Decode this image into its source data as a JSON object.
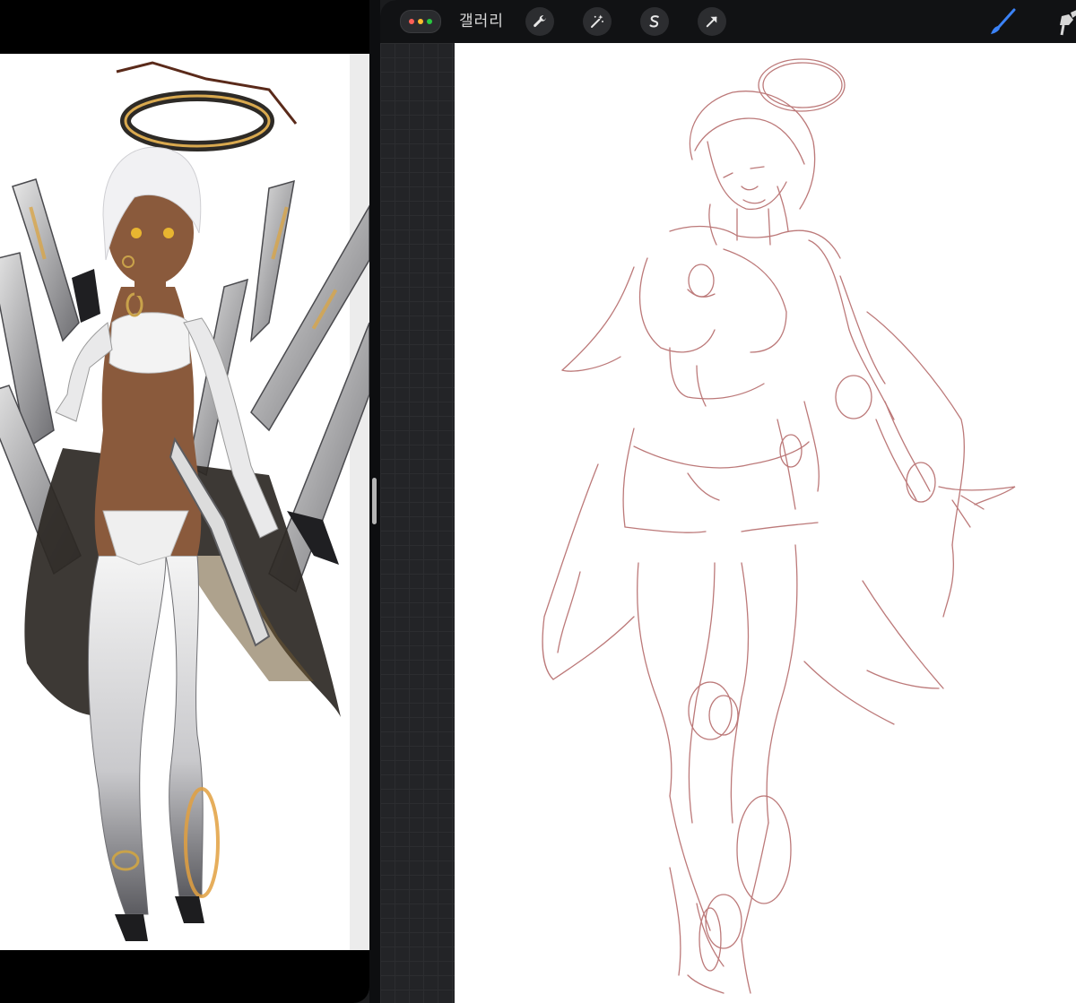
{
  "toolbar": {
    "gallery_label": "갤러리",
    "window_dots": [
      {
        "name": "red-dot",
        "color": "#ff5f57"
      },
      {
        "name": "yellow-dot",
        "color": "#febc2e"
      },
      {
        "name": "green-dot",
        "color": "#28c840"
      }
    ],
    "tools": [
      {
        "name": "actions-wrench-icon"
      },
      {
        "name": "adjustments-wand-icon"
      },
      {
        "name": "selection-s-icon"
      },
      {
        "name": "transform-arrow-icon"
      }
    ],
    "right_tools": [
      {
        "name": "brush-icon",
        "color": "#3b82f6",
        "active": true
      },
      {
        "name": "smudge-icon",
        "color": "#d6d6d6",
        "active": false
      }
    ]
  },
  "colors": {
    "sketch_stroke": "#b56b6b",
    "ref_gold": "#c9a24a",
    "ref_skin": "#8a5a3c",
    "ref_dark": "#2a2623"
  }
}
